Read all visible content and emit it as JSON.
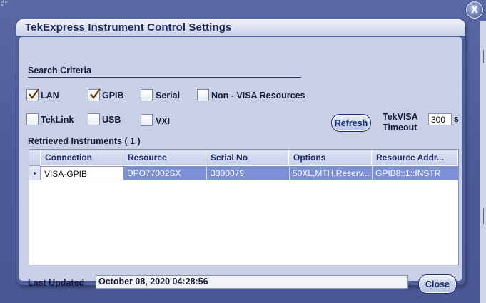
{
  "window": {
    "close_glyph": "X"
  },
  "dialog": {
    "title": "TekExpress Instrument Control Settings",
    "search_criteria_label": "Search Criteria",
    "checkboxes": [
      {
        "label": "LAN",
        "checked": true
      },
      {
        "label": "GPIB",
        "checked": true
      },
      {
        "label": "Serial",
        "checked": false
      },
      {
        "label": "Non - VISA Resources",
        "checked": false
      },
      {
        "label": "TekLink",
        "checked": false
      },
      {
        "label": "USB",
        "checked": false
      },
      {
        "label": "VXI",
        "checked": false
      }
    ],
    "refresh_label": "Refresh",
    "timeout_label_line1": "TekVISA",
    "timeout_label_line2": "Timeout",
    "timeout_value": "300",
    "timeout_unit": "s",
    "retrieved_label": "Retrieved Instruments ( 1 )",
    "table": {
      "columns": [
        "Connection",
        "Resource",
        "Serial No",
        "Options",
        "Resource Addr..."
      ],
      "rows": [
        [
          "VISA-GPIB",
          "DPO77002SX",
          "B300079",
          "50XL,MTH,Reserv...",
          "GPIB8::1::INSTR"
        ]
      ]
    },
    "last_updated_label": "Last Updated",
    "last_updated_value": "October 08, 2020 04:28:56",
    "close_label": "Close"
  },
  "colors": {
    "background": "#4f5e9c",
    "panel": "#c9d0e6",
    "selection": "#7d8fd6",
    "check": "#c9711a"
  }
}
